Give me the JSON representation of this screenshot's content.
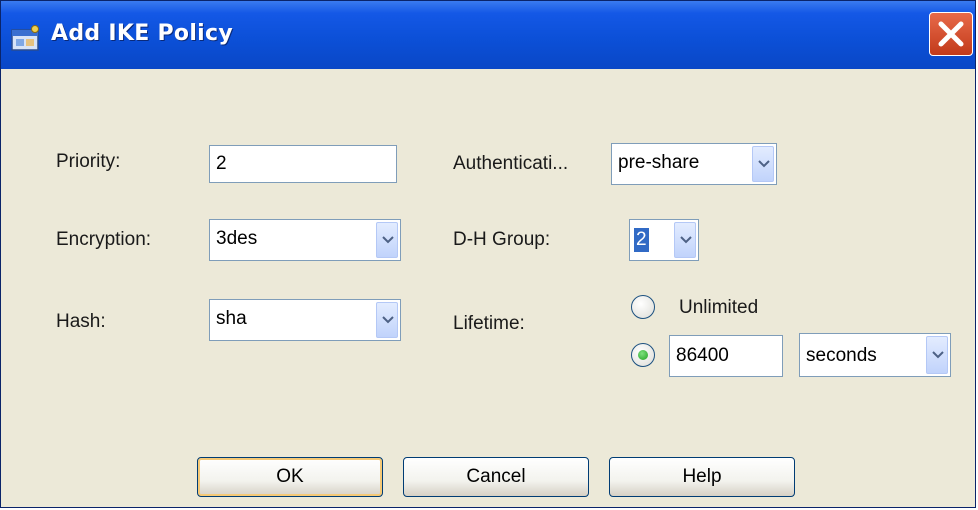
{
  "window": {
    "title": "Add IKE Policy",
    "title_icon": "window-app-icon",
    "close_icon": "close-icon"
  },
  "form": {
    "priority": {
      "label": "Priority:",
      "value": "2"
    },
    "encryption": {
      "label": "Encryption:",
      "value": "3des"
    },
    "hash": {
      "label": "Hash:",
      "value": "sha"
    },
    "authentication": {
      "label": "Authenticati...",
      "value": "pre-share"
    },
    "dh_group": {
      "label": "D-H Group:",
      "value": "2"
    },
    "lifetime": {
      "label": "Lifetime:",
      "unlimited_label": "Unlimited",
      "unlimited_selected": false,
      "value_selected": true,
      "value": "86400",
      "unit": "seconds"
    }
  },
  "buttons": {
    "ok": "OK",
    "cancel": "Cancel",
    "help": "Help"
  },
  "colors": {
    "titlebar": "#0b4fd6",
    "dialog_bg": "#ece9d8",
    "selection": "#316ac5",
    "close": "#c23a1a"
  }
}
